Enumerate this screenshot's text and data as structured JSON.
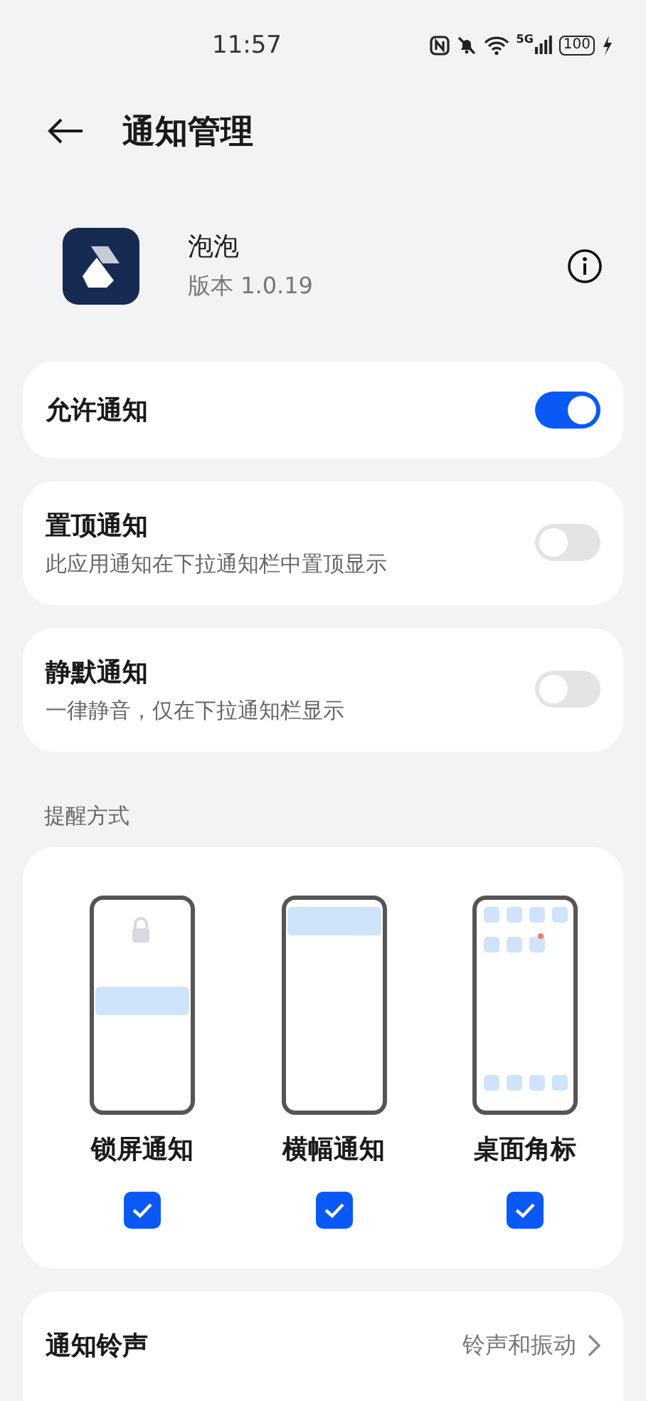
{
  "status_bar": {
    "time": "11:57",
    "network": "5G",
    "battery": "100"
  },
  "header": {
    "title": "通知管理"
  },
  "app": {
    "name": "泡泡",
    "version": "版本 1.0.19"
  },
  "toggles": [
    {
      "title": "允许通知",
      "on": true
    },
    {
      "title": "置顶通知",
      "subtitle": "此应用通知在下拉通知栏中置顶显示",
      "on": false
    },
    {
      "title": "静默通知",
      "subtitle": "一律静音，仅在下拉通知栏显示",
      "on": false
    }
  ],
  "reminder": {
    "heading": "提醒方式",
    "styles": [
      {
        "kind": "lock",
        "label": "锁屏通知",
        "checked": true
      },
      {
        "kind": "banner",
        "label": "横幅通知",
        "checked": true
      },
      {
        "kind": "badge",
        "label": "桌面角标",
        "checked": true
      }
    ]
  },
  "ringtone": {
    "title": "通知铃声",
    "value": "铃声和振动"
  }
}
